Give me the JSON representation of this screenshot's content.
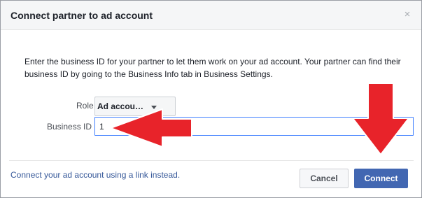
{
  "dialog": {
    "title": "Connect partner to ad account",
    "close_glyph": "×",
    "description": "Enter the business ID for your partner to let them work on your ad account. Your partner can find their business ID by going to the Business Info tab in Business Settings."
  },
  "form": {
    "role_label": "Role",
    "role_value": "Ad accou…",
    "business_id_label": "Business ID",
    "business_id_value": "1"
  },
  "footer": {
    "alt_link": "Connect your ad account using a link instead.",
    "cancel_label": "Cancel",
    "connect_label": "Connect"
  },
  "icons": {
    "close": "close-icon",
    "dropdown": "chevron-down-icon",
    "annotation": "red-arrow-icon"
  },
  "colors": {
    "primary_button": "#4267b2",
    "link": "#365899",
    "focus_border": "#4080ff",
    "annotation_arrow": "#e8232a"
  }
}
